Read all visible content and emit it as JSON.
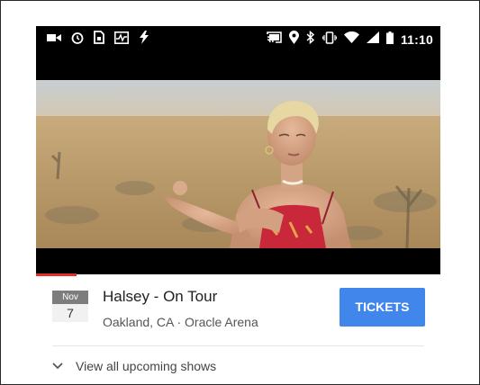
{
  "status_bar": {
    "time": "11:10",
    "left_icons": [
      "video-camera-icon",
      "alarm-icon",
      "sim-card-icon",
      "activity-icon",
      "bolt-icon"
    ],
    "right_icons": [
      "cast-icon",
      "location-pin-icon",
      "bluetooth-icon",
      "vibrate-icon",
      "wifi-icon",
      "signal-icon",
      "battery-icon"
    ]
  },
  "video": {
    "progress": 0.1
  },
  "event": {
    "month": "Nov",
    "day": "7",
    "title": "Halsey - On Tour",
    "venue": "Oakland, CA · Oracle Arena",
    "tickets_label": "TICKETS"
  },
  "more_shows": {
    "label": "View all upcoming shows",
    "icon": "chevron-down-icon"
  },
  "colors": {
    "tickets_button": "#4187eb",
    "progress_played": "#e52d27",
    "status_bar": "#000000"
  }
}
